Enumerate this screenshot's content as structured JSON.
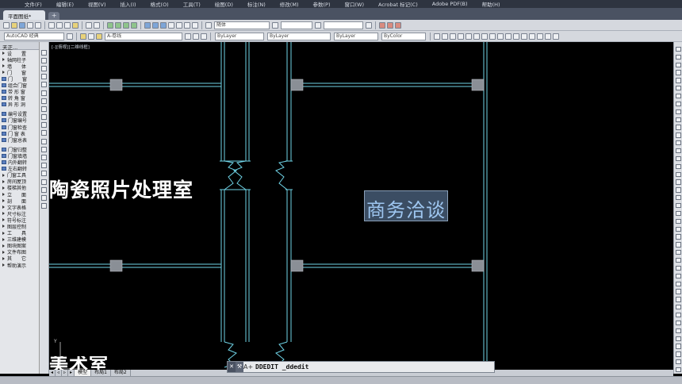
{
  "menu": [
    "文件(F)",
    "编辑(E)",
    "视图(V)",
    "插入(I)",
    "格式(O)",
    "工具(T)",
    "绘图(D)",
    "标注(N)",
    "修改(M)",
    "参数(P)",
    "窗口(W)",
    "Acrobat 标记(C)",
    "Adobe PDF(B)",
    "帮助(H)"
  ],
  "doc_tab": "平面图纸*",
  "new_tab": "+",
  "toolbar": {
    "workspace": "AutoCAD 经典",
    "layer": "A-卷线",
    "color": "ByLayer",
    "linetype": "ByLayer",
    "lineweight": "ByLayer",
    "plotstyle": "ByColor",
    "style": "随体"
  },
  "left_panel": {
    "title": "天正...",
    "items": [
      {
        "label": "设　　置",
        "kind": "arrow"
      },
      {
        "label": "轴网柱子",
        "kind": "arrow"
      },
      {
        "label": "墙　　体",
        "kind": "arrow"
      },
      {
        "label": "门　　窗",
        "kind": "arrow"
      },
      {
        "label": "门　　窗",
        "kind": "box"
      },
      {
        "label": "组合门窗",
        "kind": "box"
      },
      {
        "label": "带 形 窗",
        "kind": "box"
      },
      {
        "label": "转 角 窗",
        "kind": "box"
      },
      {
        "label": "异 形 洞",
        "kind": "box"
      },
      {
        "label": "",
        "kind": "gap"
      },
      {
        "label": "编号设置",
        "kind": "box"
      },
      {
        "label": "门窗编号",
        "kind": "box"
      },
      {
        "label": "门窗检查",
        "kind": "box"
      },
      {
        "label": "门 窗 表",
        "kind": "box"
      },
      {
        "label": "门窗总表",
        "kind": "box"
      },
      {
        "label": "",
        "kind": "gap"
      },
      {
        "label": "门窗归整",
        "kind": "box"
      },
      {
        "label": "门窗填墙",
        "kind": "box"
      },
      {
        "label": "内外翻转",
        "kind": "box"
      },
      {
        "label": "左右翻转",
        "kind": "box"
      },
      {
        "label": "门窗工具",
        "kind": "arrow"
      },
      {
        "label": "房间屋顶",
        "kind": "arrow"
      },
      {
        "label": "楼梯其他",
        "kind": "arrow"
      },
      {
        "label": "立　　面",
        "kind": "arrow"
      },
      {
        "label": "剖　　面",
        "kind": "arrow"
      },
      {
        "label": "文字表格",
        "kind": "arrow"
      },
      {
        "label": "尺寸标注",
        "kind": "arrow"
      },
      {
        "label": "符号标注",
        "kind": "arrow"
      },
      {
        "label": "图层控制",
        "kind": "arrow"
      },
      {
        "label": "工　　具",
        "kind": "arrow"
      },
      {
        "label": "三维建模",
        "kind": "arrow"
      },
      {
        "label": "图块图案",
        "kind": "arrow"
      },
      {
        "label": "文件布图",
        "kind": "arrow"
      },
      {
        "label": "其　　它",
        "kind": "arrow"
      },
      {
        "label": "帮助演示",
        "kind": "arrow"
      }
    ]
  },
  "viewport": {
    "title": "[-][俯视][二维线框]"
  },
  "drawing": {
    "room_left": "陶瓷照片处理室",
    "room_right": "商务洽谈",
    "room_bottom": "美术室",
    "ucs": "Y"
  },
  "layout_tabs": [
    "模型",
    "布局1",
    "布局2"
  ],
  "command": {
    "prompt": "A+",
    "text": "DDEDIT _ddedit"
  },
  "colors": {
    "background": "#000000",
    "wall": "#6fd3e6",
    "column": "#8a8f96",
    "selection": "#3b4d63",
    "selected_text": "#9ec6f0"
  }
}
